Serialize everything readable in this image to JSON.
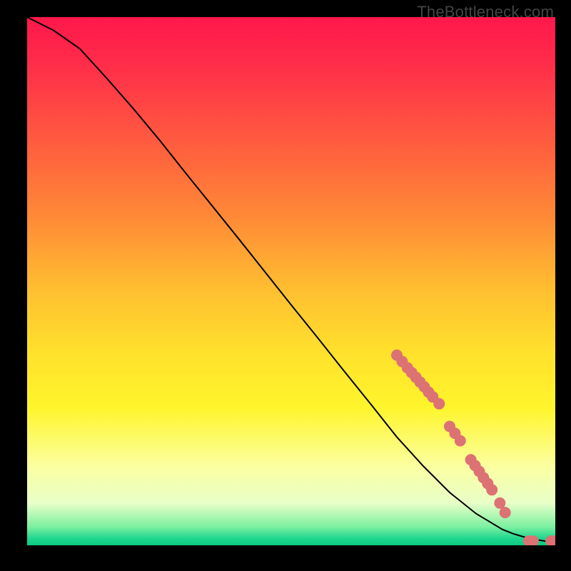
{
  "watermark": "TheBottleneck.com",
  "colors": {
    "curve": "#000000",
    "marker_fill": "#dc7274",
    "marker_stroke": "#b85a5c"
  },
  "chart_data": {
    "type": "line",
    "title": "",
    "xlabel": "",
    "ylabel": "",
    "xlim": [
      0,
      100
    ],
    "ylim": [
      0,
      100
    ],
    "series": [
      {
        "name": "curve",
        "x": [
          0,
          5,
          10,
          15,
          20,
          25,
          30,
          35,
          40,
          45,
          50,
          55,
          60,
          65,
          70,
          75,
          80,
          85,
          90,
          92,
          95,
          98,
          100
        ],
        "y": [
          100,
          97.5,
          94,
          88.5,
          82.8,
          76.8,
          70.5,
          64.3,
          58.1,
          51.8,
          45.5,
          39.3,
          33,
          26.8,
          20.5,
          15,
          10,
          6,
          3,
          2.2,
          1.3,
          0.8,
          0.8
        ]
      }
    ],
    "markers": [
      {
        "x": 70.0,
        "y": 36.0
      },
      {
        "x": 71.0,
        "y": 34.8
      },
      {
        "x": 72.0,
        "y": 33.6
      },
      {
        "x": 72.8,
        "y": 32.7
      },
      {
        "x": 73.6,
        "y": 31.8
      },
      {
        "x": 74.4,
        "y": 30.9
      },
      {
        "x": 75.2,
        "y": 30.0
      },
      {
        "x": 76.0,
        "y": 29.0
      },
      {
        "x": 76.8,
        "y": 28.1
      },
      {
        "x": 78.0,
        "y": 26.8
      },
      {
        "x": 80.0,
        "y": 22.5
      },
      {
        "x": 81.0,
        "y": 21.2
      },
      {
        "x": 82.0,
        "y": 19.8
      },
      {
        "x": 84.0,
        "y": 16.2
      },
      {
        "x": 84.8,
        "y": 15.1
      },
      {
        "x": 85.6,
        "y": 14.0
      },
      {
        "x": 86.4,
        "y": 12.8
      },
      {
        "x": 87.2,
        "y": 11.7
      },
      {
        "x": 88.0,
        "y": 10.5
      },
      {
        "x": 89.5,
        "y": 8.0
      },
      {
        "x": 90.5,
        "y": 6.2
      },
      {
        "x": 95.0,
        "y": 0.8
      },
      {
        "x": 95.8,
        "y": 0.8
      },
      {
        "x": 99.2,
        "y": 0.8
      },
      {
        "x": 100.0,
        "y": 0.8
      }
    ]
  }
}
